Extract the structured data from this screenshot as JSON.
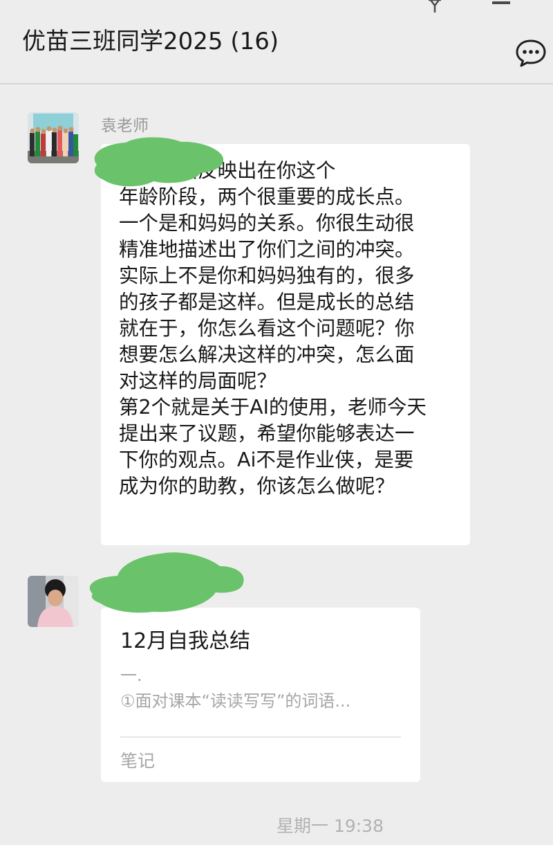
{
  "header": {
    "title": "优苗三班同学2025 (16)",
    "more_icon": "ellipsis-chat-icon",
    "top_icons": [
      "pin-icon",
      "minimize-icon"
    ]
  },
  "messages": [
    {
      "sender": "袁老师",
      "avatar": "group-photo-avatar",
      "text": "你的总结反映出在你这个\n年龄阶段，两个很重要的成长点。\n一个是和妈妈的关系。你很生动很\n精准地描述出了你们之间的冲突。\n实际上不是你和妈妈独有的，很多\n的孩子都是这样。但是成长的总结\n就在于，你怎么看这个问题呢？你\n想要怎么解决这样的冲突，怎么面\n对这样的局面呢？\n第2个就是关于AI的使用，老师今天\n提出来了议题，希望你能够表达一\n下你的观点。Ai不是作业侠，是要\n成为你的助教，你该怎么做呢？"
    },
    {
      "sender": "",
      "avatar": "student-photo-avatar",
      "card": {
        "title": "12月自我总结",
        "preview_line1": "一.",
        "preview_line2": "①面对课本“读读写写”的词语...",
        "footer": "笔记"
      }
    }
  ],
  "timestamp": "星期一 19:38",
  "colors": {
    "background": "#ededed",
    "bubble": "#ffffff",
    "redaction": "#6ac26a",
    "secondary_text": "#a6a6a6"
  }
}
